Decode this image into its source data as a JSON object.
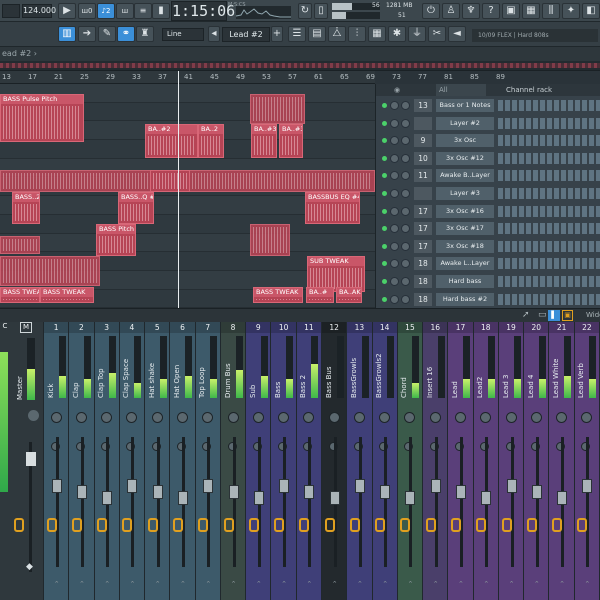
{
  "toolbar": {
    "bpm": "124.000",
    "pat_song_labels": [
      "ш0",
      "ш"
    ],
    "time_display": "1:15:06",
    "time_sub": "M:S:CS",
    "cpu_label": "1281 MB",
    "cpu_value": "56",
    "poly_value": "51",
    "snap_label": "Line",
    "pattern_label": "Lead #2",
    "hint_label": "10/09  FLEX | Hard 808s",
    "top_icons": [
      "power-icon",
      "metronome-icon",
      "mic-icon",
      "help-icon",
      "save-icon",
      "pattern-icon",
      "mixer-icon"
    ]
  },
  "tabbar": {
    "label": "ead #2 ›"
  },
  "ruler": {
    "bars": [
      "13",
      "17",
      "21",
      "25",
      "29",
      "33",
      "37",
      "41",
      "45",
      "49",
      "53",
      "57",
      "61",
      "65",
      "69",
      "73",
      "77",
      "81",
      "85",
      "89"
    ]
  },
  "playlist": {
    "clips": [
      {
        "label": "BASS Pulse Pitch"
      },
      {
        "label": "BA..#2"
      },
      {
        "label": "BA..2"
      },
      {
        "label": "BA..#3"
      },
      {
        "label": "BA..#3"
      },
      {
        "label": "BASS..2"
      },
      {
        "label": "BASS..Q #3"
      },
      {
        "label": "BASSBUS EQ #4"
      },
      {
        "label": "BASS Pitch"
      },
      {
        "label": "SUB TWEAK"
      },
      {
        "label": "BASS TWEAK"
      },
      {
        "label": "BASS TWEAK"
      },
      {
        "label": "BASS TWEAK"
      },
      {
        "label": "BA..#"
      },
      {
        "label": "BA..AK"
      }
    ]
  },
  "channel_rack": {
    "filter": "All",
    "title": "Channel rack",
    "rows": [
      {
        "num": "13",
        "name": "Bass or 1 Notes"
      },
      {
        "num": "",
        "name": "Layer #2"
      },
      {
        "num": "9",
        "name": "3x Osc"
      },
      {
        "num": "10",
        "name": "3x Osc #12"
      },
      {
        "num": "11",
        "name": "Awake B..Layer"
      },
      {
        "num": "",
        "name": "Layer #3"
      },
      {
        "num": "17",
        "name": "3x Osc #16"
      },
      {
        "num": "17",
        "name": "3x Osc #17"
      },
      {
        "num": "17",
        "name": "3x Osc #18"
      },
      {
        "num": "18",
        "name": "Awake L..Layer"
      },
      {
        "num": "18",
        "name": "Hard bass"
      },
      {
        "num": "18",
        "name": "Hard bass #2"
      }
    ]
  },
  "mixer": {
    "head_label": "Wide",
    "master_label": "Master",
    "master_head": "C",
    "master_m": "M",
    "strips": [
      {
        "num": "1",
        "name": "Kick",
        "level": 0.35,
        "color": "#3d5a6a"
      },
      {
        "num": "2",
        "name": "Clap",
        "level": 0.3,
        "color": "#3d5a6a"
      },
      {
        "num": "3",
        "name": "Clap Top",
        "level": 0.4,
        "color": "#3d5a6a"
      },
      {
        "num": "4",
        "name": "Clap Space",
        "level": 0.25,
        "color": "#3d5a6a"
      },
      {
        "num": "5",
        "name": "Hat shake",
        "level": 0.3,
        "color": "#3d5a6a"
      },
      {
        "num": "6",
        "name": "Hat Open",
        "level": 0.35,
        "color": "#3d5a6a"
      },
      {
        "num": "7",
        "name": "Top Loop",
        "level": 0.3,
        "color": "#3d5a6a"
      },
      {
        "num": "8",
        "name": "Drum Bus",
        "level": 0.45,
        "color": "#3a4a45"
      },
      {
        "num": "9",
        "name": "Sub",
        "level": 0.35,
        "color": "#3f3f78"
      },
      {
        "num": "10",
        "name": "Bass",
        "level": 0.3,
        "color": "#3f3f78"
      },
      {
        "num": "11",
        "name": "Bass 2",
        "level": 0.55,
        "color": "#3f3f78"
      },
      {
        "num": "12",
        "name": "Bass Bus",
        "level": 0.0,
        "color": "#23292d"
      },
      {
        "num": "13",
        "name": "BassGrowls",
        "level": 0.0,
        "color": "#3f3f78"
      },
      {
        "num": "14",
        "name": "BassGrowls2",
        "level": 0.0,
        "color": "#3f3f78"
      },
      {
        "num": "15",
        "name": "Chord",
        "level": 0.25,
        "color": "#3a5a4a"
      },
      {
        "num": "16",
        "name": "Insert 16",
        "level": 0.0,
        "color": "#4a3f6a"
      },
      {
        "num": "17",
        "name": "Lead",
        "level": 0.3,
        "color": "#5a3f7a"
      },
      {
        "num": "18",
        "name": "Lead2",
        "level": 0.3,
        "color": "#5a3f7a"
      },
      {
        "num": "19",
        "name": "Lead 3",
        "level": 0.3,
        "color": "#5a3f7a"
      },
      {
        "num": "20",
        "name": "Lead 4",
        "level": 0.3,
        "color": "#5a3f7a"
      },
      {
        "num": "21",
        "name": "Lead White",
        "level": 0.35,
        "color": "#5a3f7a"
      },
      {
        "num": "22",
        "name": "Lead Verb",
        "level": 0.3,
        "color": "#5a3f7a"
      }
    ]
  }
}
